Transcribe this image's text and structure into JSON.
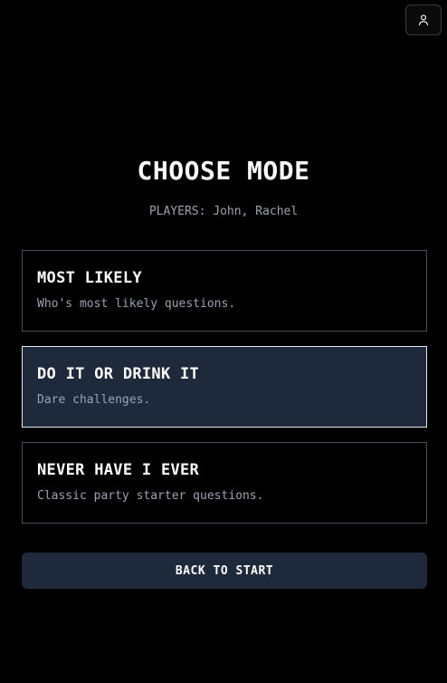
{
  "header": {
    "profile_icon": "user-icon"
  },
  "main": {
    "title": "CHOOSE MODE",
    "players_text": "PLAYERS: John, Rachel",
    "modes": [
      {
        "title": "MOST LIKELY",
        "description": "Who's most likely questions.",
        "selected": false
      },
      {
        "title": "DO IT OR DRINK IT",
        "description": "Dare challenges.",
        "selected": true
      },
      {
        "title": "NEVER HAVE I EVER",
        "description": "Classic party starter questions.",
        "selected": false
      }
    ],
    "back_label": "BACK TO START"
  },
  "colors": {
    "background": "#000000",
    "card_selected": "#1e293b",
    "card_border": "#4a4f5a",
    "muted_text": "#9aa3b2",
    "text": "#ffffff"
  }
}
